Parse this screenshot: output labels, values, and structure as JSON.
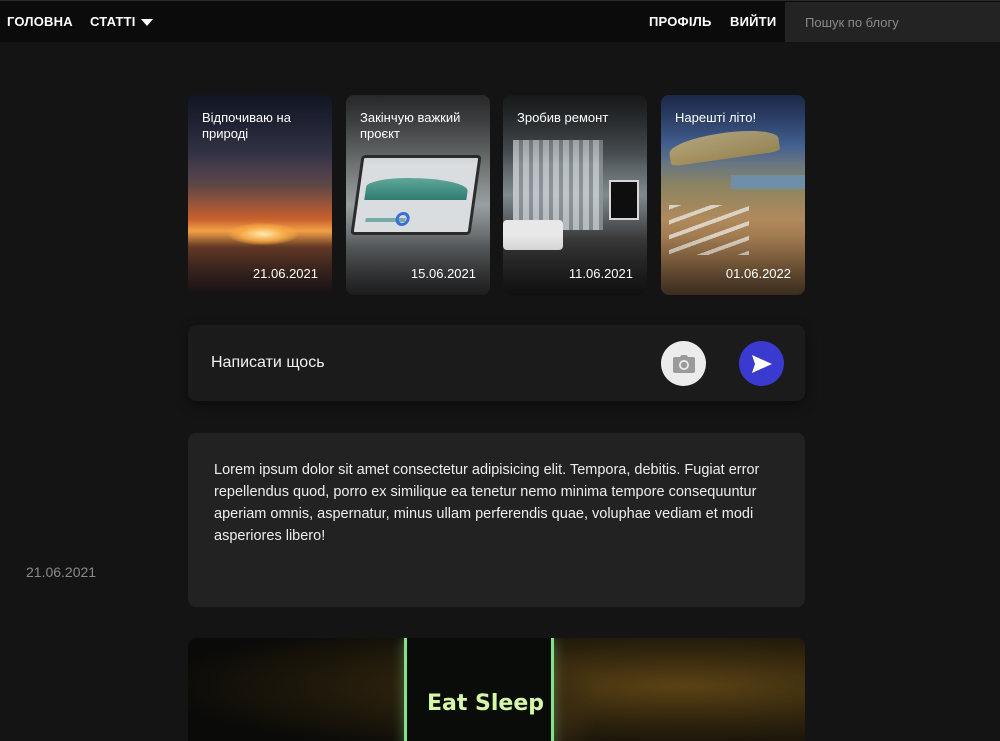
{
  "nav": {
    "home": "ГОЛОВНА",
    "articles": "СТАТТІ",
    "profile": "ПРОФІЛЬ",
    "logout": "ВИЙТИ",
    "search_placeholder": "Пошук по блогу"
  },
  "stories": [
    {
      "title": "Відпочиваю на природі",
      "date": "21.06.2021"
    },
    {
      "title": "Закінчую важкий проєкт",
      "date": "15.06.2021"
    },
    {
      "title": "Зробив ремонт",
      "date": "11.06.2021"
    },
    {
      "title": "Нарешті літо!",
      "date": "01.06.2022"
    }
  ],
  "composer": {
    "placeholder": "Написати щось",
    "photo_icon": "camera-icon",
    "send_icon": "send-icon"
  },
  "post": {
    "text": "Lorem ipsum dolor sit amet consectetur adipisicing elit. Tempora, debitis. Fugiat error repellendus quod, porro ex similique ea tenetur nemo minima tempore consequuntur aperiam omnis, aspernatur, minus ullam perferendis quae, voluphae vediam et modi asperiores libero!",
    "date": "21.06.2021"
  },
  "image_post": {
    "phone_text": "Eat Sleep"
  },
  "colors": {
    "background": "#141414",
    "topbar": "#0b0b0b",
    "card": "#222222",
    "send_button": "#3a3ad0",
    "photo_button": "#ececec"
  }
}
